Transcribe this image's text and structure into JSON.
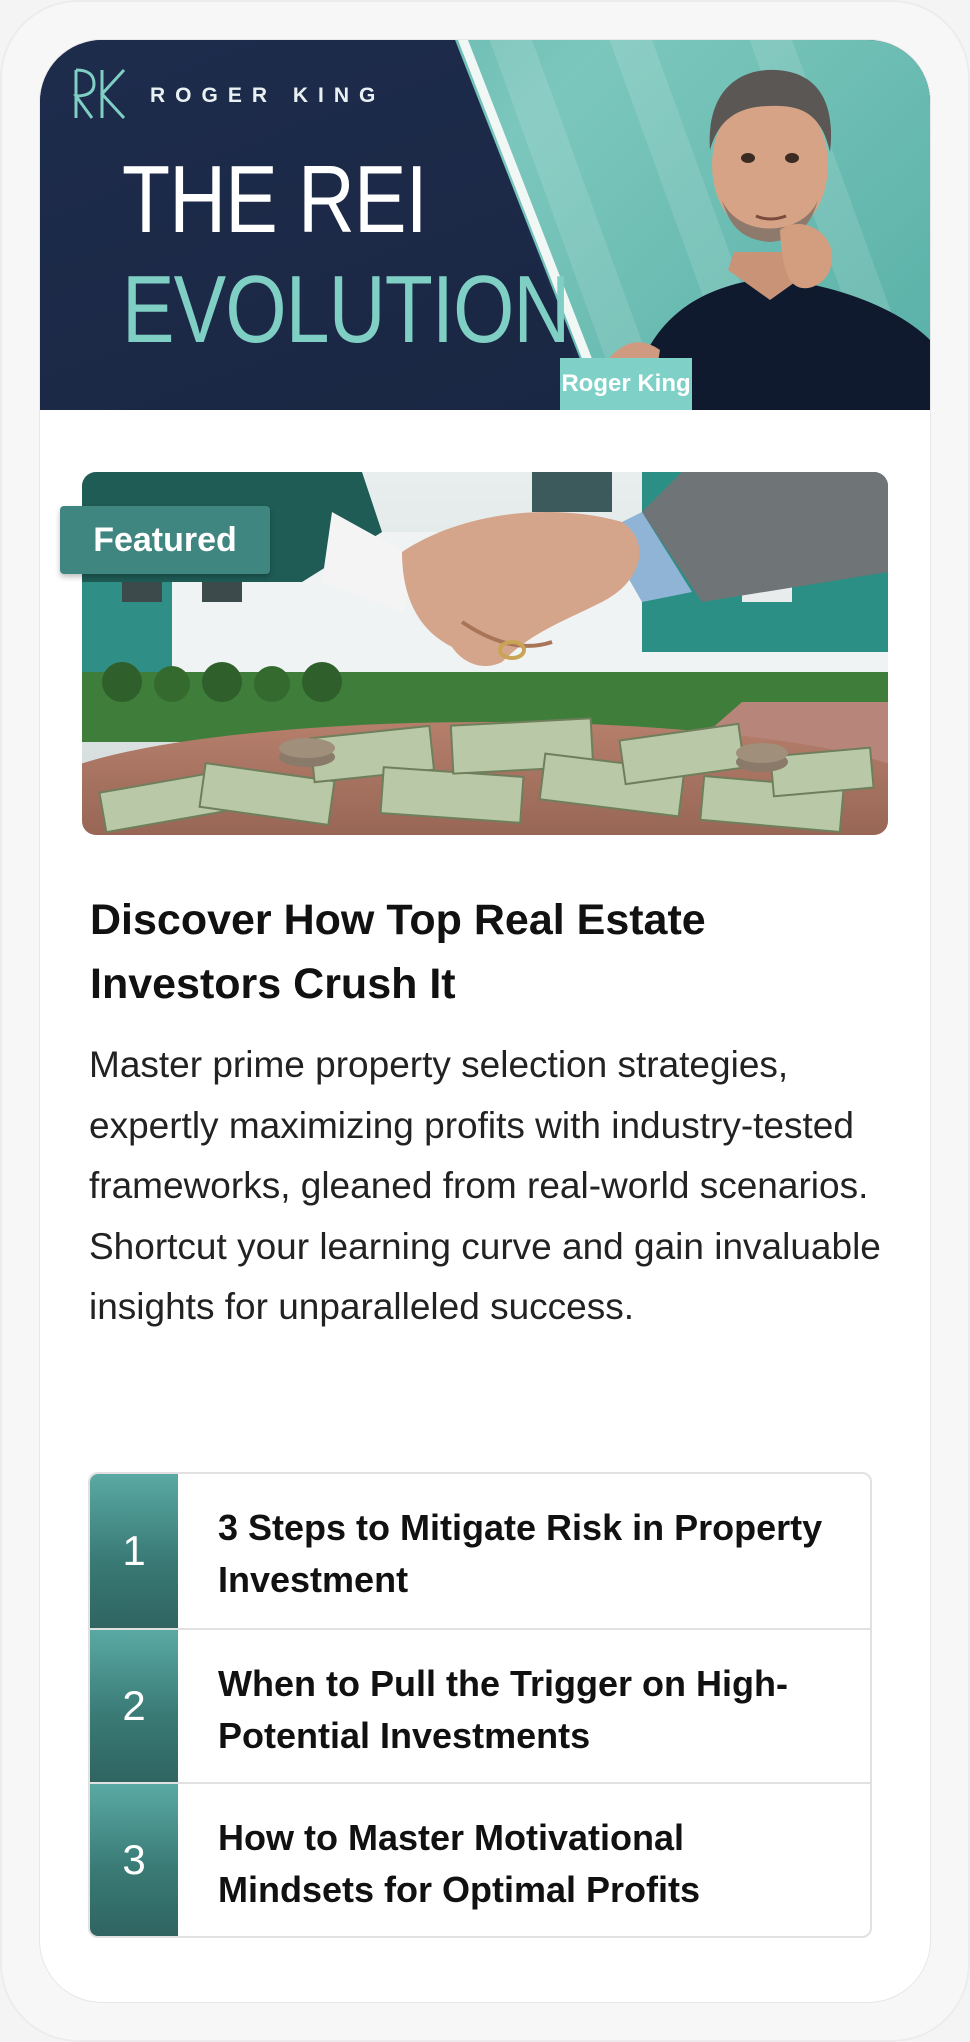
{
  "header": {
    "brand": "ROGER KING",
    "title_line1": "THE REI",
    "title_line2": "EVOLUTION",
    "presenter_name": "Roger King"
  },
  "feature": {
    "badge": "Featured",
    "image_subject": "handshake-over-cash-icon"
  },
  "headline": "Discover How Top Real Estate Investors Crush It",
  "body": "Master prime property selection strategies, expertly maximizing profits with industry-tested frameworks, gleaned from real-world scenarios. Shortcut your learning curve and gain invaluable insights for unparalleled success.",
  "steps": [
    {
      "number": "1",
      "text": "3 Steps to Mitigate Risk in Property Investment"
    },
    {
      "number": "2",
      "text": "When to Pull the Trigger on High-Potential Investments"
    },
    {
      "number": "3",
      "text": "How to Master Motivational Mindsets for Optimal Profits"
    }
  ],
  "colors": {
    "navy": "#1c2a4a",
    "teal": "#4fa79f",
    "teal_light": "#7fcfc4",
    "badge": "#3f8580"
  }
}
